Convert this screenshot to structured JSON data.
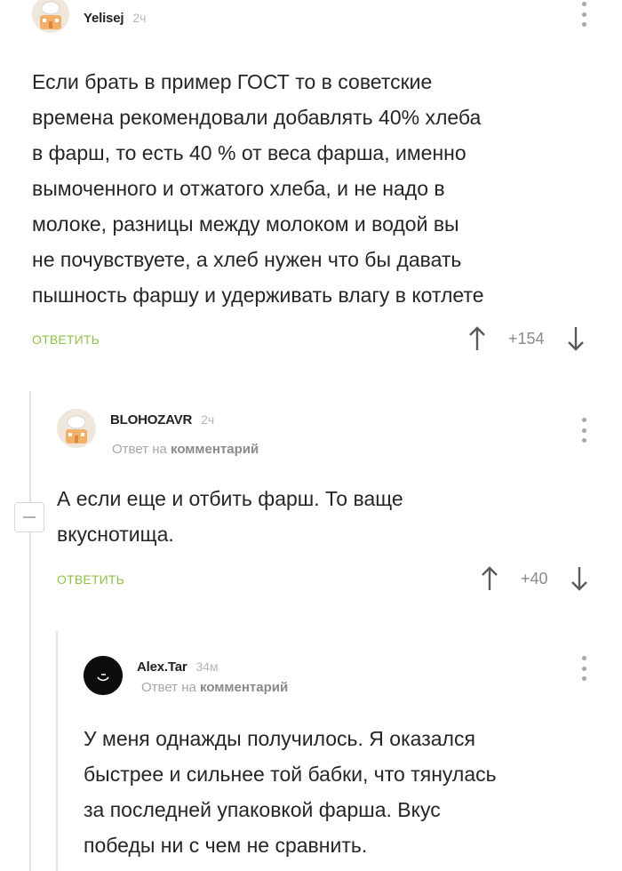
{
  "comments": [
    {
      "username": "Yelisej",
      "time": "2ч",
      "avatar_icon": "chef-avatar-icon",
      "text_lines": [
        "Если брать в пример ГОСТ то в советские",
        "времена рекомендовали добавлять 40% хлеба",
        "в фарш, то есть 40 % от веса фарша, именно",
        "вымоченного и отжатого хлеба, и не надо в",
        "молоке, разницы между молоком и водой вы",
        "не почувствуете, а хлеб нужен что бы давать",
        "пышность фаршу и удерживать влагу в котлете"
      ],
      "reply_label": "ОТВЕТИТЬ",
      "rating": "+154"
    },
    {
      "username": "BLOHOZAVR",
      "time": "2ч",
      "avatar_icon": "chef-avatar-icon",
      "reply_to_prefix": "Ответ на",
      "reply_to_link": "комментарий",
      "text_lines": [
        "А если еще и отбить фарш. То ваще",
        "вкуснотища."
      ],
      "reply_label": "ОТВЕТИТЬ",
      "rating": "+40"
    },
    {
      "username": "Alex.Tar",
      "time": "34м",
      "avatar_icon": "dark-avatar-icon",
      "reply_to_prefix": "Ответ на",
      "reply_to_link": "комментарий",
      "text_lines": [
        "У меня однажды получилось. Я оказался",
        "быстрее и сильнее той бабки, что тянулась",
        "за последней упаковкой фарша. Вкус",
        "победы ни с чем не сравнить."
      ]
    }
  ],
  "colors": {
    "accent_green": "#8ec04a",
    "muted_gray": "#a6a6a6",
    "thread_line": "#e3e3e3"
  }
}
